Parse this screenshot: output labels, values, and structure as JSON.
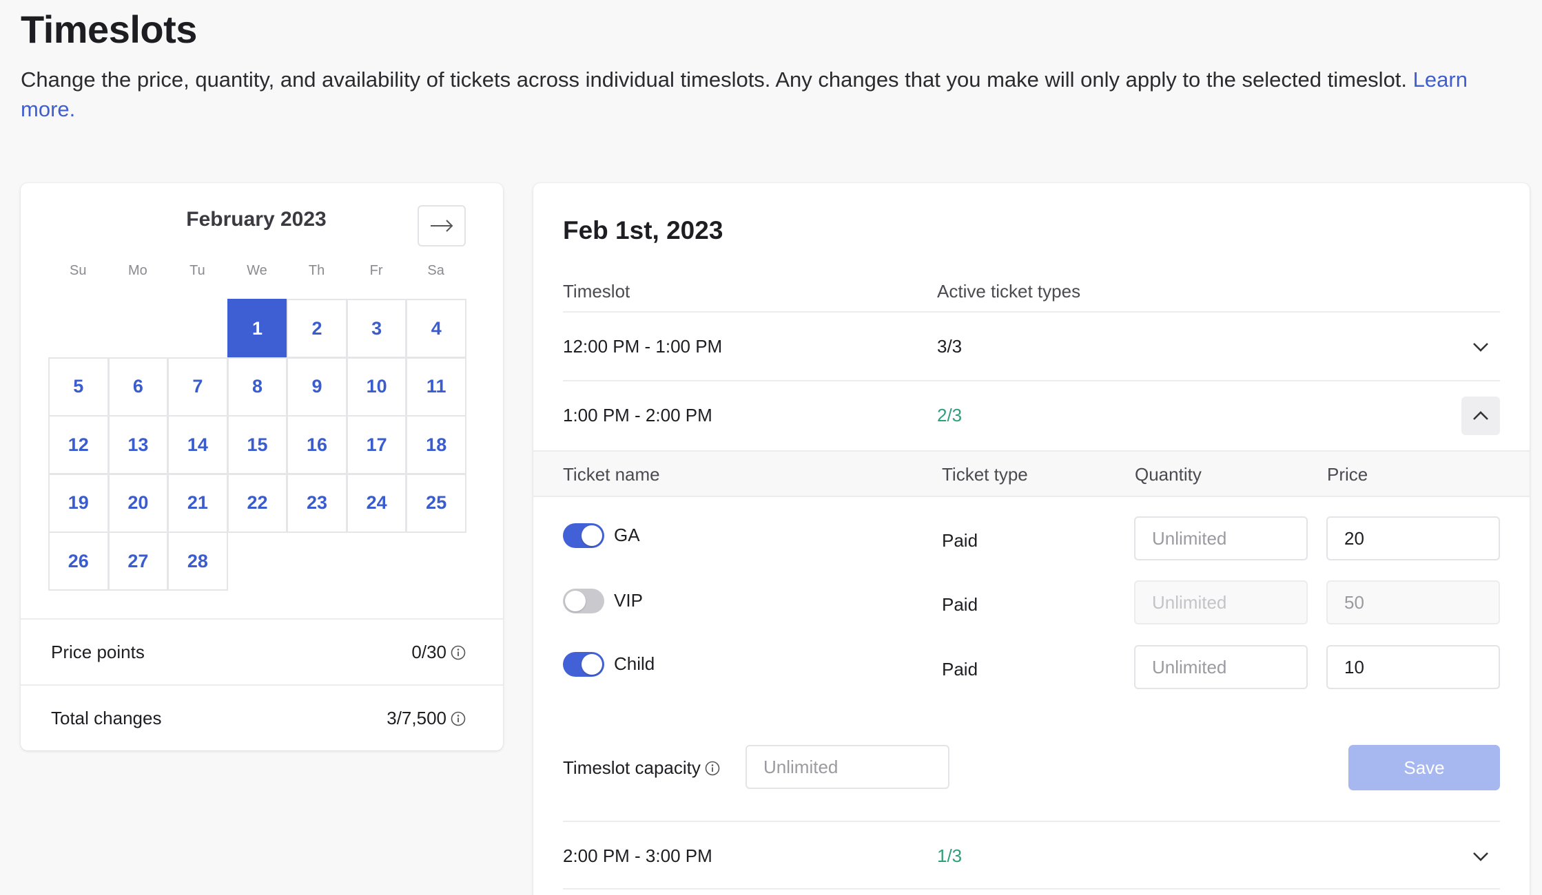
{
  "header": {
    "title": "Timeslots",
    "description": "Change the price, quantity, and availability of tickets across individual timeslots. Any changes that you make will only apply to the selected timeslot. ",
    "learn_more": "Learn more."
  },
  "calendar": {
    "month": "February 2023",
    "weekdays": [
      "Su",
      "Mo",
      "Tu",
      "We",
      "Th",
      "Fr",
      "Sa"
    ],
    "selected_day": "1",
    "days": [
      "1",
      "2",
      "3",
      "4",
      "5",
      "6",
      "7",
      "8",
      "9",
      "10",
      "11",
      "12",
      "13",
      "14",
      "15",
      "16",
      "17",
      "18",
      "19",
      "20",
      "21",
      "22",
      "23",
      "24",
      "25",
      "26",
      "27",
      "28"
    ],
    "price_points_label": "Price points",
    "price_points_value": "0/30",
    "total_changes_label": "Total changes",
    "total_changes_value": "3/7,500"
  },
  "timeslots": {
    "date_title": "Feb 1st, 2023",
    "col_timeslot": "Timeslot",
    "col_active": "Active ticket types",
    "rows": [
      {
        "time": "12:00 PM - 1:00 PM",
        "active": "3/3"
      },
      {
        "time": "1:00 PM - 2:00 PM",
        "active": "2/3"
      },
      {
        "time": "2:00 PM - 3:00 PM",
        "active": "1/3"
      }
    ],
    "expanded": {
      "col_name": "Ticket name",
      "col_type": "Ticket type",
      "col_quantity": "Quantity",
      "col_price": "Price",
      "tickets": [
        {
          "name": "GA",
          "enabled": true,
          "type": "Paid",
          "quantity_placeholder": "Unlimited",
          "price": "20"
        },
        {
          "name": "VIP",
          "enabled": false,
          "type": "Paid",
          "quantity_placeholder": "Unlimited",
          "price": "50"
        },
        {
          "name": "Child",
          "enabled": true,
          "type": "Paid",
          "quantity_placeholder": "Unlimited",
          "price": "10"
        }
      ],
      "capacity_label": "Timeslot capacity",
      "capacity_placeholder": "Unlimited",
      "save_label": "Save"
    }
  },
  "colors": {
    "accent": "#3e5fd4",
    "active_green": "#2f9e7c",
    "save_disabled": "#a7b7ef"
  }
}
